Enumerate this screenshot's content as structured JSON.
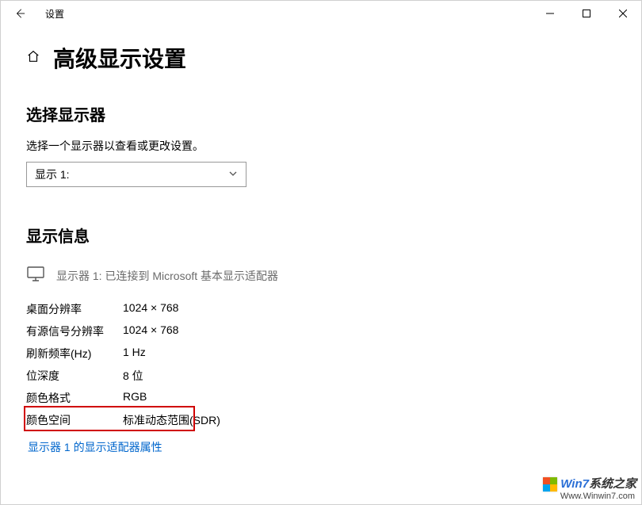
{
  "titlebar": {
    "window_title": "设置"
  },
  "page": {
    "title": "高级显示设置"
  },
  "select_display": {
    "heading": "选择显示器",
    "description": "选择一个显示器以查看或更改设置。",
    "selected": "显示 1:"
  },
  "display_info": {
    "heading": "显示信息",
    "monitor_label": "显示器 1: 已连接到 Microsoft 基本显示适配器",
    "rows": [
      {
        "key": "桌面分辨率",
        "val": "1024 × 768"
      },
      {
        "key": "有源信号分辨率",
        "val": "1024 × 768"
      },
      {
        "key": "刷新频率(Hz)",
        "val": "1 Hz"
      },
      {
        "key": "位深度",
        "val": "8 位"
      },
      {
        "key": "颜色格式",
        "val": "RGB"
      },
      {
        "key": "颜色空间",
        "val": "标准动态范围(SDR)"
      }
    ],
    "adapter_link": "显示器 1 的显示适配器属性"
  },
  "watermark": {
    "brand_prefix": "Win7",
    "brand_suffix": "系统之家",
    "url": "Www.Winwin7.com"
  }
}
